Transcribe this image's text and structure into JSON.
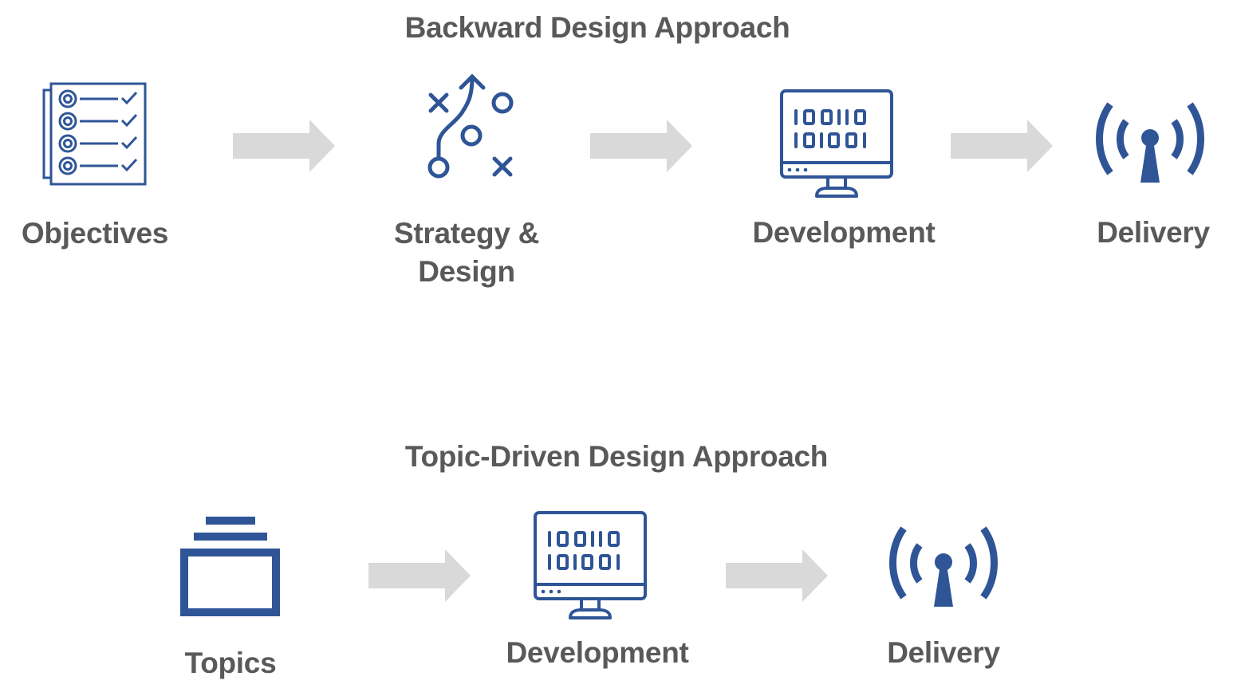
{
  "sections": [
    {
      "title": "Backward Design Approach",
      "steps": [
        {
          "label": "Objectives",
          "icon": "checklist-icon"
        },
        {
          "label_lines": [
            "Strategy &",
            "Design"
          ],
          "icon": "strategy-play-icon"
        },
        {
          "label": "Development",
          "icon": "binary-monitor-icon"
        },
        {
          "label": "Delivery",
          "icon": "broadcast-antenna-icon"
        }
      ]
    },
    {
      "title": "Topic-Driven Design Approach",
      "steps": [
        {
          "label": "Topics",
          "icon": "stacked-folder-icon"
        },
        {
          "label": "Development",
          "icon": "binary-monitor-icon"
        },
        {
          "label": "Delivery",
          "icon": "broadcast-antenna-icon"
        }
      ]
    }
  ],
  "monitor_binary": [
    "100110",
    "101001"
  ],
  "colors": {
    "icon": "#2F5597",
    "text": "#595959",
    "arrow": "#D9D9D9"
  }
}
